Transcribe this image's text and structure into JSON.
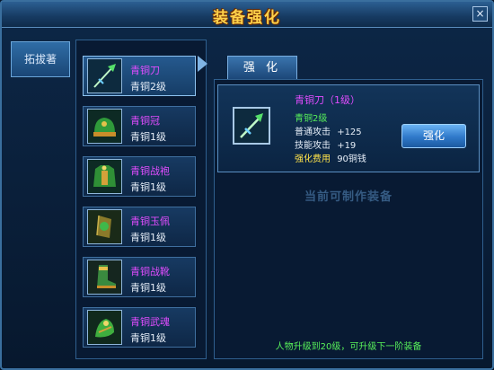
{
  "window": {
    "title": "装备强化",
    "close_icon": "×"
  },
  "left_tab": {
    "label": "拓拔著"
  },
  "items": [
    {
      "name": "青铜刀",
      "level": "青铜2级",
      "icon": "blade-icon",
      "selected": true
    },
    {
      "name": "青铜冠",
      "level": "青铜1级",
      "icon": "helmet-icon",
      "selected": false
    },
    {
      "name": "青铜战袍",
      "level": "青铜1级",
      "icon": "armor-icon",
      "selected": false
    },
    {
      "name": "青铜玉佩",
      "level": "青铜1级",
      "icon": "pendant-icon",
      "selected": false
    },
    {
      "name": "青铜战靴",
      "level": "青铜1级",
      "icon": "boots-icon",
      "selected": false
    },
    {
      "name": "青铜武魂",
      "level": "青铜1级",
      "icon": "spirit-icon",
      "selected": false
    }
  ],
  "tab": {
    "label": "强 化"
  },
  "detail": {
    "name": "青铜刀（1级）",
    "grade": "青铜2级",
    "stat1_label": "普通攻击",
    "stat1_value": "+125",
    "stat2_label": "技能攻击",
    "stat2_value": "+19",
    "cost_label": "强化费用",
    "cost_value": "90铜钱",
    "icon": "blade-icon"
  },
  "button": {
    "label": "强化"
  },
  "section_title": "当前可制作装备",
  "bottom_note": "人物升级到20级，可升级下一阶装备"
}
